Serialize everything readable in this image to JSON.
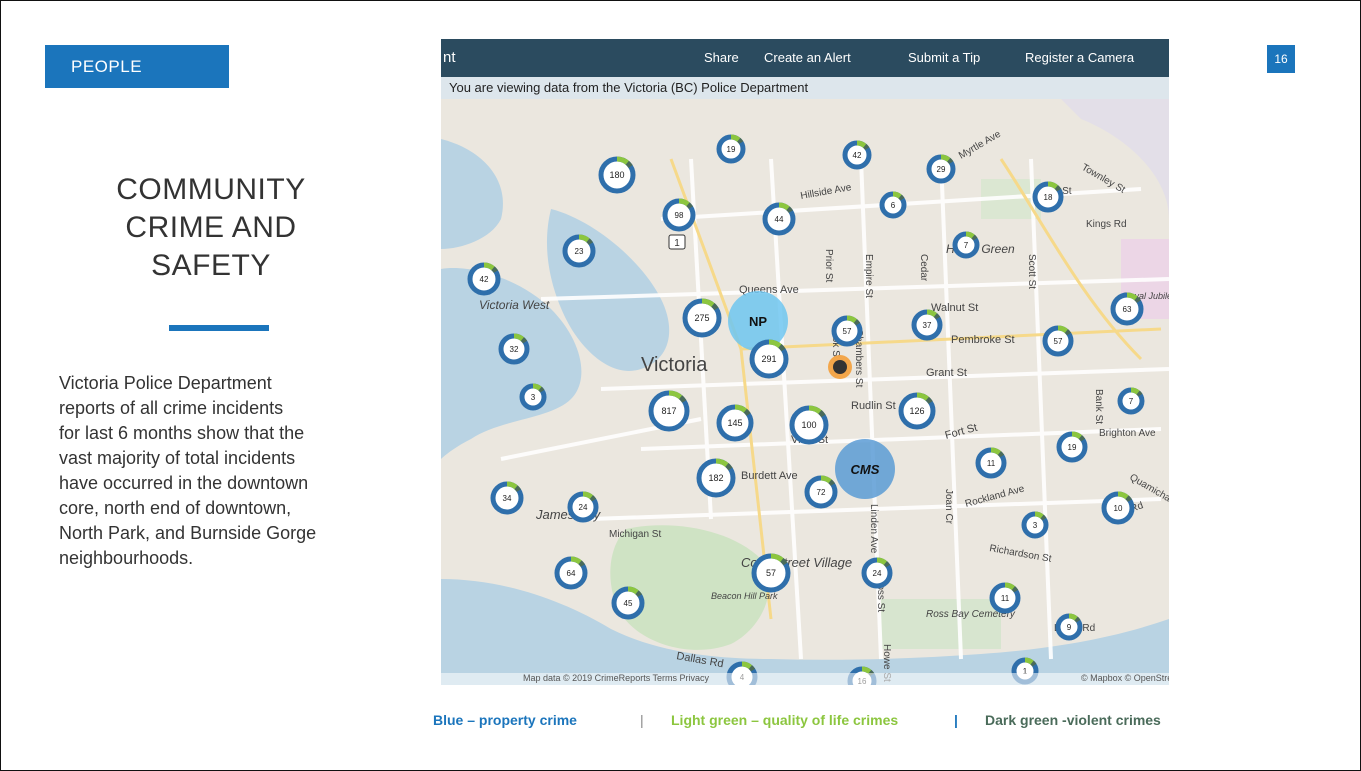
{
  "slide": {
    "section_tag": "PEOPLE",
    "page_number": "16",
    "title_lines": [
      "COMMUNITY",
      "CRIME AND",
      "SAFETY"
    ],
    "body_lines": [
      "Victoria Police Department",
      "reports of all crime incidents",
      "for last 6 months show that the",
      "vast majority of total incidents",
      "have occurred in the downtown",
      "core, north end of downtown,",
      "North Park, and Burnside Gorge",
      "neighbourhoods."
    ]
  },
  "map": {
    "brand": "nt",
    "nav": [
      "Share",
      "Create an Alert",
      "Submit a Tip",
      "Register a Camera"
    ],
    "banner": "You are viewing data from the Victoria (BC) Police Department",
    "footer_left": "Map data © 2019 CrimeReports   Terms   Privacy",
    "footer_right": "© Mapbox © OpenStre",
    "labels": [
      "Victoria",
      "Victoria West",
      "James Bay",
      "Cook Street Village",
      "Beacon Hill Park",
      "Ross Bay Cemetery",
      "Harris Green",
      "Royal Jubilee Hospital",
      "Queens Ave",
      "Walnut St",
      "Pembroke St",
      "Grant St",
      "Rudlin St",
      "Fort St",
      "View St",
      "Burdett Ave",
      "Rockland Ave",
      "Richardson St",
      "Michigan St",
      "Dallas Rd",
      "Hillside Ave",
      "Ryan St",
      "Kings Rd",
      "Lillian Rd",
      "Bay Rd",
      "Myrtle Ave",
      "Empire St",
      "Prior St",
      "Cedar",
      "Scott St",
      "Cook St",
      "Chambers St",
      "Linden Ave",
      "Moss St",
      "Joan Cr",
      "Howe St",
      "Bank St",
      "Quamichan St",
      "Brighton Ave",
      "Townley St",
      "Linden Ave"
    ],
    "clusters": [
      "180",
      "19",
      "42",
      "29",
      "98",
      "44",
      "6",
      "7",
      "18",
      "23",
      "42",
      "275",
      "57",
      "37",
      "63",
      "32",
      "291",
      "57",
      "3",
      "817",
      "145",
      "100",
      "126",
      "7",
      "19",
      "11",
      "182",
      "72",
      "34",
      "24",
      "10",
      "3",
      "64",
      "45",
      "57",
      "24",
      "11",
      "9",
      "4",
      "16",
      "1"
    ],
    "zones": [
      "NP",
      "CMS"
    ],
    "route_shield": "1"
  },
  "legend": {
    "property": "Blue – property crime",
    "sep1": "|",
    "quality": "Light green – quality of life crimes",
    "sep2": "|",
    "violent": "Dark green -violent crimes"
  },
  "colors": {
    "accent": "#1b75bc",
    "nav_bg": "#2b4b5f",
    "property": "#2f6fab",
    "quality": "#8cc63f",
    "violent": "#4a6b5a",
    "zone_np": "#6ec6f0",
    "zone_cms": "#5b9bd5"
  }
}
